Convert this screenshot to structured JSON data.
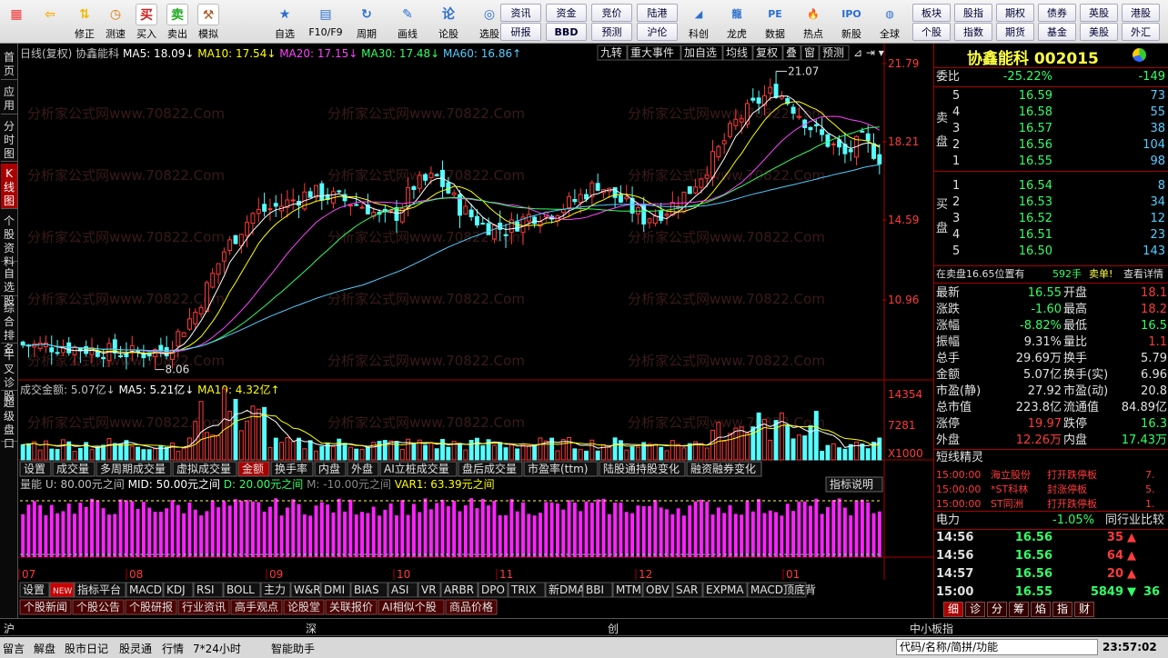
{
  "toolbar": {
    "main": [
      {
        "label": "",
        "icon": "windows-icon"
      },
      {
        "label": "",
        "icon": "back-arrow-icon"
      },
      {
        "label": "修正",
        "icon": "up-down-icon"
      },
      {
        "label": "测速",
        "icon": "clock-icon"
      },
      {
        "label": "买入",
        "icon": "buy-icon"
      },
      {
        "label": "卖出",
        "icon": "sell-icon"
      },
      {
        "label": "模拟",
        "icon": "hammer-icon"
      }
    ],
    "group2": [
      {
        "label": "自选"
      },
      {
        "label": "F10/F9"
      },
      {
        "label": "周期"
      },
      {
        "label": "画线"
      },
      {
        "label": "论股"
      },
      {
        "label": "选股"
      }
    ],
    "small_top": [
      "资讯",
      "资金",
      "竞价",
      "陆港"
    ],
    "small_bottom": [
      "研报",
      "BBD",
      "预测",
      "沪伦"
    ],
    "group3": [
      {
        "label": "科创"
      },
      {
        "label": "龙虎"
      },
      {
        "label": "数据"
      },
      {
        "label": "热点"
      },
      {
        "label": "新股"
      },
      {
        "label": "全球"
      }
    ],
    "small2_top": [
      "板块",
      "股指",
      "期权",
      "债券",
      "英股",
      "港股"
    ],
    "small2_bottom": [
      "个股",
      "指数",
      "期货",
      "基金",
      "美股",
      "外汇"
    ]
  },
  "leftnav": [
    "首页",
    "应用",
    "分时图",
    "K线图",
    "个股资料",
    "自选股",
    "综合排名",
    "牛叉诊股",
    "超级盘口"
  ],
  "chart": {
    "header": "日线(复权)  协鑫能科",
    "ma": [
      {
        "t": "MA5: 18.09",
        "color": "#ffffff"
      },
      {
        "t": "MA10: 17.54",
        "color": "#ffff00"
      },
      {
        "t": "MA20: 17.15",
        "color": "#ff44ff"
      },
      {
        "t": "MA30: 17.48",
        "color": "#33ff66"
      },
      {
        "t": "MA60: 16.86",
        "color": "#55ccff"
      }
    ],
    "tools": [
      "九转",
      "重大事件",
      "加自选",
      "均线",
      "复权",
      "叠",
      "窗",
      "预测"
    ],
    "price_axis": [
      "21.79",
      "18.21",
      "14.59",
      "10.96"
    ],
    "high_label": "21.07",
    "low_label": "8.06",
    "vol_header": [
      {
        "t": "成交金额: 5.07亿",
        "color": "#c0c0c0"
      },
      {
        "t": "MA5: 5.21亿",
        "color": "#ffffff"
      },
      {
        "t": "MA10: 4.32亿",
        "color": "#ffff00"
      }
    ],
    "vol_axis": [
      "14354",
      "7281",
      "X1000"
    ],
    "sub_tabs": [
      "设置",
      "成交量",
      "多周期成交量",
      "虚拟成交量",
      "金额",
      "换手率",
      "内盘",
      "外盘",
      "AI立桩成交量",
      "盘后成交量",
      "市盈率(ttm)",
      "陆股通持股变化",
      "融资融券变化"
    ],
    "ind_header": [
      {
        "t": "量能 U: 80.00元之间",
        "color": "#c0c0c0"
      },
      {
        "t": "MID: 50.00元之间",
        "color": "#ffffff"
      },
      {
        "t": "D: 20.00元之间",
        "color": "#33ff66"
      },
      {
        "t": "M: -10.00元之间",
        "color": "#888888"
      },
      {
        "t": "VAR1: 63.39元之间",
        "color": "#ffff00"
      }
    ],
    "ind_btn": "指标说明",
    "months": [
      "07",
      "08",
      "09",
      "10",
      "11",
      "12",
      "01"
    ],
    "ind_tabs": [
      "设置",
      "NEW",
      "指标平台",
      "MACD",
      "KDJ",
      "RSI",
      "BOLL",
      "主力",
      "W&R",
      "DMI",
      "BIAS",
      "ASI",
      "VR",
      "ARBR",
      "DPO",
      "TRIX",
      "新DMA",
      "BBI",
      "MTM",
      "OBV",
      "SAR",
      "EXPMA",
      "MACD顶底背"
    ],
    "info_tabs": [
      "个股新闻",
      "个股公告",
      "个股研报",
      "行业资讯",
      "高手观点",
      "论股堂",
      "关联报价",
      "AI相似个股",
      "商品价格"
    ],
    "watermark": "分析家公式网www.70822.Com"
  },
  "quote": {
    "title": "协鑫能科 002015",
    "weibi_label": "委比",
    "weibi": "-25.22%",
    "weidiff": "-149",
    "sell_label": "卖盘",
    "buy_label": "买盘",
    "sells": [
      [
        "5",
        "16.59",
        "73"
      ],
      [
        "4",
        "16.58",
        "55"
      ],
      [
        "3",
        "16.57",
        "38"
      ],
      [
        "2",
        "16.56",
        "104"
      ],
      [
        "1",
        "16.55",
        "98"
      ]
    ],
    "buys": [
      [
        "1",
        "16.54",
        "8"
      ],
      [
        "2",
        "16.53",
        "34"
      ],
      [
        "3",
        "16.52",
        "12"
      ],
      [
        "4",
        "16.51",
        "23"
      ],
      [
        "5",
        "16.50",
        "143"
      ]
    ],
    "notice": "在卖盘16.65位置有",
    "notice_vol": "592手",
    "notice_tag": "卖单!",
    "notice_link": "查看详情",
    "stats": [
      [
        "最新",
        "16.55",
        "g",
        "开盘",
        "18.1",
        "r"
      ],
      [
        "涨跌",
        "-1.60",
        "g",
        "最高",
        "18.2",
        "r"
      ],
      [
        "涨幅",
        "-8.82%",
        "g",
        "最低",
        "16.5",
        "g"
      ],
      [
        "振幅",
        "9.31%",
        "w",
        "量比",
        "1.1",
        "r"
      ],
      [
        "总手",
        "29.69万",
        "w",
        "换手",
        "5.79",
        "w"
      ],
      [
        "金额",
        "5.07亿",
        "w",
        "换手(实)",
        "6.96",
        "w"
      ],
      [
        "市盈(静)",
        "27.92",
        "w",
        "市盈(动)",
        "20.8",
        "w"
      ],
      [
        "总市值",
        "223.8亿",
        "w",
        "流通值",
        "84.89亿",
        "w"
      ],
      [
        "涨停",
        "19.97",
        "r",
        "跌停",
        "16.3",
        "g"
      ],
      [
        "外盘",
        "12.26万",
        "r",
        "内盘",
        "17.43万",
        "g"
      ]
    ],
    "news_title": "短线精灵",
    "news": [
      [
        "15:00:00",
        "海立股份",
        "打开跌停板",
        "7."
      ],
      [
        "15:00:00",
        "*ST科林",
        "封涨停板",
        "5."
      ],
      [
        "15:00:00",
        "ST同洲",
        "打开跌停板",
        "1."
      ]
    ],
    "industry": "电力",
    "industry_pct": "-1.05%",
    "industry_btn": "同行业比较",
    "ticks": [
      [
        "14:56",
        "16.56",
        "35",
        "up"
      ],
      [
        "14:56",
        "16.56",
        "64",
        "up"
      ],
      [
        "14:57",
        "16.56",
        "20",
        "up"
      ],
      [
        "15:00",
        "16.55",
        "5849",
        "down",
        "36"
      ]
    ],
    "tabs": [
      "细",
      "诊",
      "分",
      "筹",
      "焰",
      "指",
      "财"
    ]
  },
  "status": {
    "sh": "沪",
    "sz": "深",
    "cy": "创",
    "zx": "中小板指",
    "search": "代码/名称/简拼/功能",
    "time": "23:57:02",
    "links": [
      "留言",
      "解盘",
      "股市日记",
      "股灵通",
      "行情",
      "7*24小时",
      "智能助手"
    ]
  }
}
